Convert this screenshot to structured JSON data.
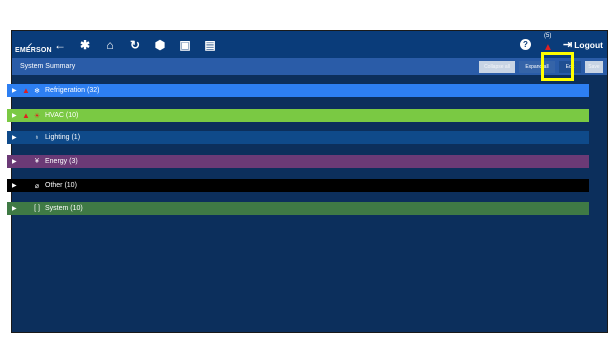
{
  "topbar": {
    "brand": "EMERSON",
    "icons": [
      "back-arrow-icon",
      "gear-icon",
      "home-icon",
      "refresh-icon",
      "box-icon",
      "calendar-icon",
      "calculator-icon"
    ],
    "help_glyph": "?",
    "alarm_count": "(5)",
    "logout_label": "Logout"
  },
  "subbar": {
    "title": "System Summary",
    "collapse_label": "Collapse all",
    "expand_label": "Expand all",
    "edit_label": "Edit",
    "save_label": "Save"
  },
  "groups": [
    {
      "label": "Refrigeration (32)",
      "color": "#2d7ff2",
      "icon": "snowflake-icon",
      "glyph": "❄",
      "alarm": true
    },
    {
      "label": "HVAC (10)",
      "color": "#7ac943",
      "icon": "hvac-icon",
      "glyph": "☀",
      "alarm": true
    },
    {
      "label": "Lighting (1)",
      "color": "#0f4a8a",
      "icon": "lightbulb-icon",
      "glyph": "💡",
      "alarm": false
    },
    {
      "label": "Energy (3)",
      "color": "#6b3a76",
      "icon": "energy-icon",
      "glyph": "⚡",
      "alarm": false
    },
    {
      "label": "Other (10)",
      "color": "#000000",
      "icon": "other-icon",
      "glyph": "⌀",
      "alarm": false
    },
    {
      "label": "System (10)",
      "color": "#3f7a45",
      "icon": "system-icon",
      "glyph": "▢",
      "alarm": false
    }
  ],
  "colors": {
    "topbar": "#0a3c7a",
    "subbar": "#2a5ca8",
    "background": "#0c2f5c",
    "highlight": "#ffff00",
    "alarm": "#e02020"
  }
}
